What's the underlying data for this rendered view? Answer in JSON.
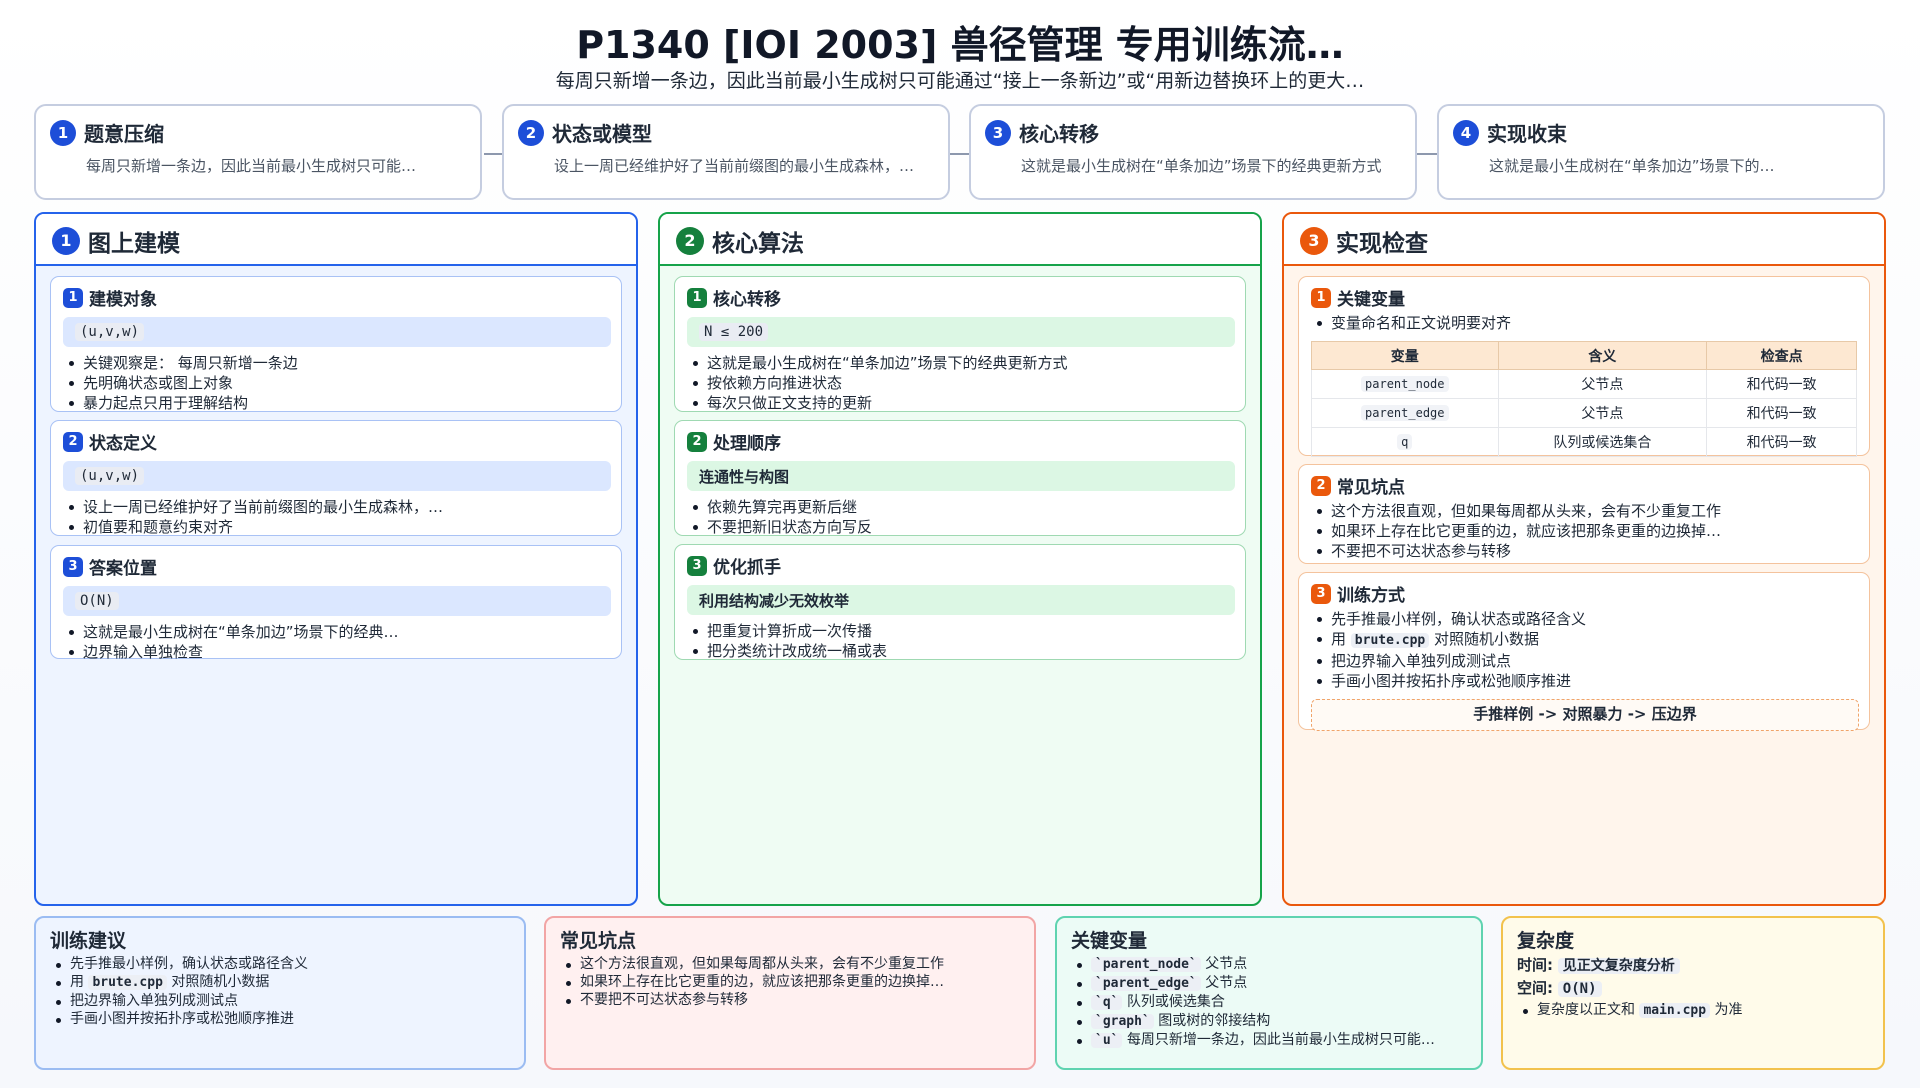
{
  "title": "P1340 [IOI 2003] 兽径管理 专用训练流…",
  "subtitle": "每周只新增一条边，因此当前最小生成树只可能通过“接上一条新边”或“用新边替换环上的更大…",
  "steps": [
    {
      "num": "1",
      "title": "题意压缩",
      "desc": "每周只新增一条边，因此当前最小生成树只可能…"
    },
    {
      "num": "2",
      "title": "状态或模型",
      "desc": "设上一周已经维护好了当前前缀图的最小生成森林，…"
    },
    {
      "num": "3",
      "title": "核心转移",
      "desc": "这就是最小生成树在“单条加边”场景下的经典更新方式"
    },
    {
      "num": "4",
      "title": "实现收束",
      "desc": "这就是最小生成树在“单条加边”场景下的…"
    }
  ],
  "col1": {
    "num": "1",
    "title": "图上建模",
    "cards": [
      {
        "num": "1",
        "title": "建模对象",
        "code": "(u,v,w)",
        "items": [
          "关键观察是： 每周只新增一条边",
          "先明确状态或图上对象",
          "暴力起点只用于理解结构"
        ]
      },
      {
        "num": "2",
        "title": "状态定义",
        "code": "(u,v,w)",
        "items": [
          "设上一周已经维护好了当前前缀图的最小生成森林，…",
          "初值要和题意约束对齐"
        ]
      },
      {
        "num": "3",
        "title": "答案位置",
        "code": "O(N)",
        "items": [
          "这就是最小生成树在“单条加边”场景下的经典…",
          "边界输入单独检查"
        ]
      }
    ]
  },
  "col2": {
    "num": "2",
    "title": "核心算法",
    "cards": [
      {
        "num": "1",
        "title": "核心转移",
        "code": "N ≤ 200",
        "items": [
          "这就是最小生成树在“单条加边”场景下的经典更新方式",
          "按依赖方向推进状态",
          "每次只做正文支持的更新"
        ]
      },
      {
        "num": "2",
        "title": "处理顺序",
        "chip": "连通性与构图",
        "items": [
          "依赖先算完再更新后继",
          "不要把新旧状态方向写反"
        ]
      },
      {
        "num": "3",
        "title": "优化抓手",
        "chip": "利用结构减少无效枚举",
        "items": [
          "把重复计算折成一次传播",
          "把分类统计改成统一桶或表"
        ]
      }
    ]
  },
  "col3": {
    "num": "3",
    "title": "实现检查",
    "vars": {
      "num": "1",
      "title": "关键变量",
      "note": "变量命名和正文说明要对齐",
      "headers": [
        "变量",
        "含义",
        "检查点"
      ],
      "rows": [
        [
          "parent_node",
          "父节点",
          "和代码一致"
        ],
        [
          "parent_edge",
          "父节点",
          "和代码一致"
        ],
        [
          "q",
          "队列或候选集合",
          "和代码一致"
        ]
      ]
    },
    "pitfalls": {
      "num": "2",
      "title": "常见坑点",
      "items": [
        "这个方法很直观，但如果每周都从头来，会有不少重复工作",
        "如果环上存在比它更重的边，就应该把那条更重的边换掉…",
        "不要把不可达状态参与转移"
      ]
    },
    "training": {
      "num": "3",
      "title": "训练方式",
      "items": [
        "先手推最小样例，确认状态或路径含义",
        "手画小图并按拓扑序或松弛顺序推进"
      ],
      "code_pre": "用",
      "code": "brute.cpp",
      "code_post": "对照随机小数据",
      "item3": "把边界输入单独列成测试点",
      "footer": "手推样例 -> 对照暴力 -> 压边界"
    }
  },
  "bottom": {
    "advice": {
      "title": "训练建议",
      "item1": "先手推最小样例，确认状态或路径含义",
      "code_pre": "用",
      "code": "brute.cpp",
      "code_post": "对照随机小数据",
      "item3": "把边界输入单独列成测试点",
      "item4": "手画小图并按拓扑序或松弛顺序推进"
    },
    "pitfalls": {
      "title": "常见坑点",
      "items": [
        "这个方法很直观，但如果每周都从头来，会有不少重复工作",
        "如果环上存在比它更重的边，就应该把那条更重的边换掉…",
        "不要把不可达状态参与转移"
      ]
    },
    "vars": {
      "title": "关键变量",
      "items": [
        {
          "code": "`parent_node`",
          "text": "父节点"
        },
        {
          "code": "`parent_edge`",
          "text": "父节点"
        },
        {
          "code": "`q`",
          "text": "队列或候选集合"
        },
        {
          "code": "`graph`",
          "text": "图或树的邻接结构"
        },
        {
          "code": "`u`",
          "text": "每周只新增一条边，因此当前最小生成树只可能…"
        }
      ]
    },
    "complexity": {
      "title": "复杂度",
      "time_label": "时间:",
      "time_value": "见正文复杂度分析",
      "space_label": "空间:",
      "space_value": "O(N)",
      "note_pre": "复杂度以正文和",
      "note_code": "main.cpp",
      "note_post": "为准"
    }
  }
}
